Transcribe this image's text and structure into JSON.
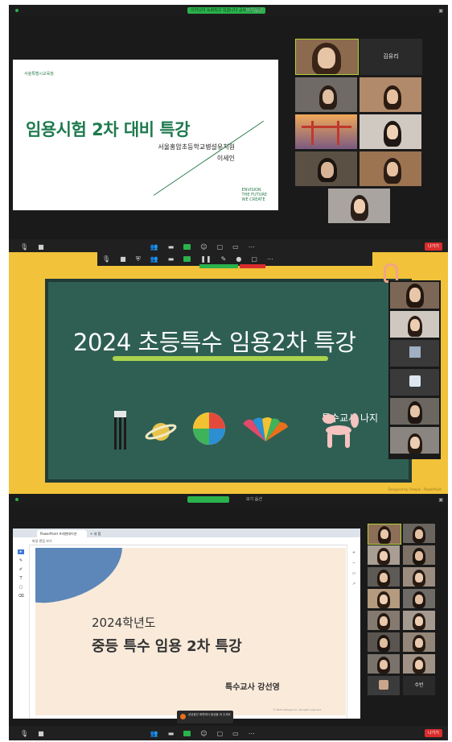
{
  "panel1": {
    "status_badge": "이러닝이 녹화되고 있습니다 공유중인 화면",
    "view_label": "보기 옵션",
    "slide": {
      "logo": "서울특별시교육청",
      "title": "임용시험 2차 대비 특강",
      "subtitle": "서울홍암초등학교병설유치원",
      "presenter": "이세인",
      "brand_line1": "ENVISION",
      "brand_line2": "THE FUTURE",
      "brand_line3": "WE CREATE"
    },
    "name_tile": "김유리",
    "end_button": "나가기",
    "colors": {
      "zoom_green": "#2bb24c",
      "zoom_red": "#d92d2d",
      "slide_title": "#1e7a4e"
    }
  },
  "panel2": {
    "board_title": "2024 초등특수 임용2차 특강",
    "author": "특수교사 나지",
    "footer": "Designed by Freepik · PowerPoint",
    "colors": {
      "board": "#2f5f53",
      "frame": "#f1c23a",
      "chalk": "#a9d34c"
    }
  },
  "panel3": {
    "browser_tab": "PowerPoint 프레젠테이션",
    "browser_tab2": "+ 새 탭",
    "menu": "파일   편집   보기",
    "slide": {
      "year": "2024학년도",
      "title": "중등 특수 임용 2차 특강",
      "author": "특수교사 강선영",
      "copyright": "© 2023 slidesgo Inc. All rights reserved."
    },
    "notification": "공유중인 화면에서 음성을 켜 주세요",
    "name_tile": "수빈",
    "colors": {
      "blob": "#5c87b8",
      "slide_bg": "#f9eada"
    }
  }
}
